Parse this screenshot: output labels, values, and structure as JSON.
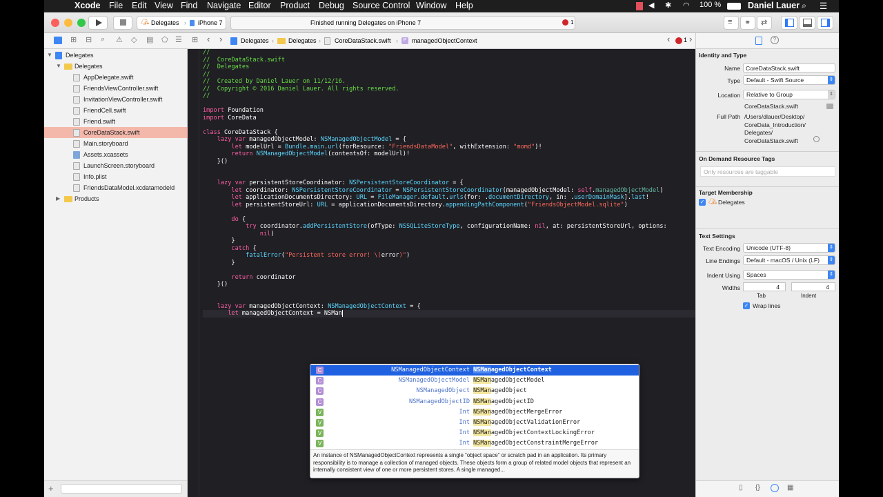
{
  "menubar": {
    "apple": "",
    "app": "Xcode",
    "items": [
      "File",
      "Edit",
      "View",
      "Find",
      "Navigate",
      "Editor",
      "Product",
      "Debug",
      "Source Control",
      "Window",
      "Help"
    ],
    "battery": "100 %",
    "user": "Daniel Lauer"
  },
  "toolbar": {
    "scheme": "Delegates",
    "device": "iPhone 7",
    "status": "Finished running Delegates on iPhone 7",
    "errors": "1"
  },
  "jumpbar": {
    "crumbs": [
      "Delegates",
      "Delegates",
      "CoreDataStack.swift",
      "managedObjectContext"
    ],
    "errors": "1"
  },
  "navigator": {
    "rows": [
      {
        "label": "Delegates",
        "depth": 0,
        "kind": "project",
        "disclosure": "open"
      },
      {
        "label": "Delegates",
        "depth": 1,
        "kind": "folder",
        "disclosure": "open"
      },
      {
        "label": "AppDelegate.swift",
        "depth": 2,
        "kind": "swift"
      },
      {
        "label": "FriendsViewController.swift",
        "depth": 2,
        "kind": "swift"
      },
      {
        "label": "InvitationViewController.swift",
        "depth": 2,
        "kind": "swift"
      },
      {
        "label": "FriendCell.swift",
        "depth": 2,
        "kind": "swift"
      },
      {
        "label": "Friend.swift",
        "depth": 2,
        "kind": "swift"
      },
      {
        "label": "CoreDataStack.swift",
        "depth": 2,
        "kind": "swift",
        "selected": true
      },
      {
        "label": "Main.storyboard",
        "depth": 2,
        "kind": "storyboard"
      },
      {
        "label": "Assets.xcassets",
        "depth": 2,
        "kind": "assets"
      },
      {
        "label": "LaunchScreen.storyboard",
        "depth": 2,
        "kind": "storyboard"
      },
      {
        "label": "Info.plist",
        "depth": 2,
        "kind": "plist"
      },
      {
        "label": "FriendsDataModel.xcdatamodeld",
        "depth": 2,
        "kind": "datamodel"
      },
      {
        "label": "Products",
        "depth": 1,
        "kind": "folder",
        "disclosure": "closed"
      }
    ]
  },
  "code_lines": [
    [
      [
        "c",
        "//"
      ]
    ],
    [
      [
        "c",
        "//  CoreDataStack.swift"
      ]
    ],
    [
      [
        "c",
        "//  Delegates"
      ]
    ],
    [
      [
        "c",
        "//"
      ]
    ],
    [
      [
        "c",
        "//  Created by Daniel Lauer on 11/12/16."
      ]
    ],
    [
      [
        "c",
        "//  Copyright © 2016 Daniel Lauer. All rights reserved."
      ]
    ],
    [
      [
        "c",
        "//"
      ]
    ],
    [],
    [
      [
        "k",
        "import"
      ],
      [
        "p",
        " Foundation"
      ]
    ],
    [
      [
        "k",
        "import"
      ],
      [
        "p",
        " CoreData"
      ]
    ],
    [],
    [
      [
        "k",
        "class"
      ],
      [
        "p",
        " CoreDataStack {"
      ]
    ],
    [
      [
        "p",
        "    "
      ],
      [
        "k",
        "lazy var"
      ],
      [
        "p",
        " managedObjectModel: "
      ],
      [
        "t",
        "NSManagedObjectModel"
      ],
      [
        "p",
        " = {"
      ]
    ],
    [
      [
        "p",
        "        "
      ],
      [
        "k",
        "let"
      ],
      [
        "p",
        " modelUrl = "
      ],
      [
        "t",
        "Bundle"
      ],
      [
        "p",
        "."
      ],
      [
        "t",
        "main"
      ],
      [
        "p",
        "."
      ],
      [
        "t",
        "url"
      ],
      [
        "p",
        "(forResource: "
      ],
      [
        "s",
        "\"FriendsDataModel\""
      ],
      [
        "p",
        ", withExtension: "
      ],
      [
        "s",
        "\"momd\""
      ],
      [
        "p",
        ")!"
      ]
    ],
    [
      [
        "p",
        "        "
      ],
      [
        "k",
        "return"
      ],
      [
        "p",
        " "
      ],
      [
        "t",
        "NSManagedObjectModel"
      ],
      [
        "p",
        "(contentsOf: modelUrl)!"
      ]
    ],
    [
      [
        "p",
        "    }()"
      ]
    ],
    [],
    [],
    [
      [
        "p",
        "    "
      ],
      [
        "k",
        "lazy var"
      ],
      [
        "p",
        " persistentStoreCoordinator: "
      ],
      [
        "t",
        "NSPersistentStoreCoordinator"
      ],
      [
        "p",
        " = {"
      ]
    ],
    [
      [
        "p",
        "        "
      ],
      [
        "k",
        "let"
      ],
      [
        "p",
        " coordinator: "
      ],
      [
        "t",
        "NSPersistentStoreCoordinator"
      ],
      [
        "p",
        " = "
      ],
      [
        "t",
        "NSPersistentStoreCoordinator"
      ],
      [
        "p",
        "(managedObjectModel: "
      ],
      [
        "k",
        "self"
      ],
      [
        "p",
        "."
      ],
      [
        "f",
        "managedObjectModel"
      ],
      [
        "p",
        ")"
      ]
    ],
    [
      [
        "p",
        "        "
      ],
      [
        "k",
        "let"
      ],
      [
        "p",
        " applicationDocumentsDirectory: "
      ],
      [
        "t",
        "URL"
      ],
      [
        "p",
        " = "
      ],
      [
        "t",
        "FileManager"
      ],
      [
        "p",
        "."
      ],
      [
        "t",
        "default"
      ],
      [
        "p",
        "."
      ],
      [
        "t",
        "urls"
      ],
      [
        "p",
        "(for: ."
      ],
      [
        "t",
        "documentDirectory"
      ],
      [
        "p",
        ", in: ."
      ],
      [
        "t",
        "userDomainMask"
      ],
      [
        "p",
        "]."
      ],
      [
        "t",
        "last"
      ],
      [
        "p",
        "!"
      ]
    ],
    [
      [
        "p",
        "        "
      ],
      [
        "k",
        "let"
      ],
      [
        "p",
        " persistentStoreUrl: "
      ],
      [
        "t",
        "URL"
      ],
      [
        "p",
        " = applicationDocumentsDirectory."
      ],
      [
        "t",
        "appendingPathComponent"
      ],
      [
        "p",
        "("
      ],
      [
        "s",
        "\"FriendsObjectModel.sqlite\""
      ],
      [
        "p",
        ")"
      ]
    ],
    [],
    [
      [
        "p",
        "        "
      ],
      [
        "k",
        "do"
      ],
      [
        "p",
        " {"
      ]
    ],
    [
      [
        "p",
        "            "
      ],
      [
        "k",
        "try"
      ],
      [
        "p",
        " coordinator."
      ],
      [
        "t",
        "addPersistentStore"
      ],
      [
        "p",
        "(ofType: "
      ],
      [
        "t",
        "NSSQLiteStoreType"
      ],
      [
        "p",
        ", configurationName: "
      ],
      [
        "k",
        "nil"
      ],
      [
        "p",
        ", at: persistentStoreUrl, options:"
      ]
    ],
    [
      [
        "p",
        "                "
      ],
      [
        "k",
        "nil"
      ],
      [
        "p",
        ")"
      ]
    ],
    [
      [
        "p",
        "        }"
      ]
    ],
    [
      [
        "p",
        "        "
      ],
      [
        "k",
        "catch"
      ],
      [
        "p",
        " {"
      ]
    ],
    [
      [
        "p",
        "            "
      ],
      [
        "t",
        "fatalError"
      ],
      [
        "p",
        "("
      ],
      [
        "s",
        "\"Persistent store error! \\("
      ],
      [
        "p",
        "error"
      ],
      [
        "s",
        ")\""
      ],
      [
        "p",
        ")"
      ]
    ],
    [
      [
        "p",
        "        }"
      ]
    ],
    [],
    [
      [
        "p",
        "        "
      ],
      [
        "k",
        "return"
      ],
      [
        "p",
        " coordinator"
      ]
    ],
    [
      [
        "p",
        "    }()"
      ]
    ],
    [],
    [],
    [
      [
        "p",
        "    "
      ],
      [
        "k",
        "lazy var"
      ],
      [
        "p",
        " managedObjectContext: "
      ],
      [
        "t",
        "NSManagedObjectContext"
      ],
      [
        "p",
        " = {"
      ]
    ],
    [
      [
        "p",
        "       "
      ],
      [
        "k",
        "let"
      ],
      [
        "p",
        " managedObjectContext = NSMan"
      ]
    ]
  ],
  "autocomplete": {
    "items": [
      {
        "badge": "C",
        "type": "NSManagedObjectContext",
        "match": "NSMan",
        "rest": "agedObjectContext",
        "selected": true
      },
      {
        "badge": "C",
        "type": "NSManagedObjectModel",
        "match": "NSMan",
        "rest": "agedObjectModel"
      },
      {
        "badge": "C",
        "type": "NSManagedObject",
        "match": "NSMan",
        "rest": "agedObject"
      },
      {
        "badge": "C",
        "type": "NSManagedObjectID",
        "match": "NSMan",
        "rest": "agedObjectID"
      },
      {
        "badge": "V",
        "type": "Int",
        "match": "NSMan",
        "rest": "agedObjectMergeError"
      },
      {
        "badge": "V",
        "type": "Int",
        "match": "NSMan",
        "rest": "agedObjectValidationError"
      },
      {
        "badge": "V",
        "type": "Int",
        "match": "NSMan",
        "rest": "agedObjectContextLockingError"
      },
      {
        "badge": "V",
        "type": "Int",
        "match": "NSMan",
        "rest": "agedObjectConstraintMergeError"
      }
    ],
    "description": "An instance of NSManagedObjectContext represents a single “object space” or scratch pad in an application. Its primary responsibility is to manage a collection of managed objects. These objects form a group of related model objects that represent an internally consistent view of one or more persistent stores. A single managed...",
    "colors": {
      "class": "#b28fd6",
      "var": "#7ab55b",
      "selected": "#1f61e0"
    }
  },
  "inspector": {
    "identity_header": "Identity and Type",
    "name_label": "Name",
    "name_value": "CoreDataStack.swift",
    "type_label": "Type",
    "type_value": "Default - Swift Source",
    "location_label": "Location",
    "location_value": "Relative to Group",
    "location_file": "CoreDataStack.swift",
    "fullpath_label": "Full Path",
    "fullpath_lines": [
      "/Users/dlauer/Desktop/",
      "CoreData_Introduction/",
      "Delegates/",
      "CoreDataStack.swift"
    ],
    "odr_header": "On Demand Resource Tags",
    "odr_placeholder": "Only resources are taggable",
    "target_header": "Target Membership",
    "target_name": "Delegates",
    "text_header": "Text Settings",
    "encoding_label": "Text Encoding",
    "encoding_value": "Unicode (UTF-8)",
    "endings_label": "Line Endings",
    "endings_value": "Default - macOS / Unix (LF)",
    "indent_label": "Indent Using",
    "indent_value": "Spaces",
    "widths_label": "Widths",
    "tab_value": "4",
    "indent_width_value": "4",
    "tab_caption": "Tab",
    "indent_caption": "Indent",
    "wrap_label": "Wrap lines"
  }
}
